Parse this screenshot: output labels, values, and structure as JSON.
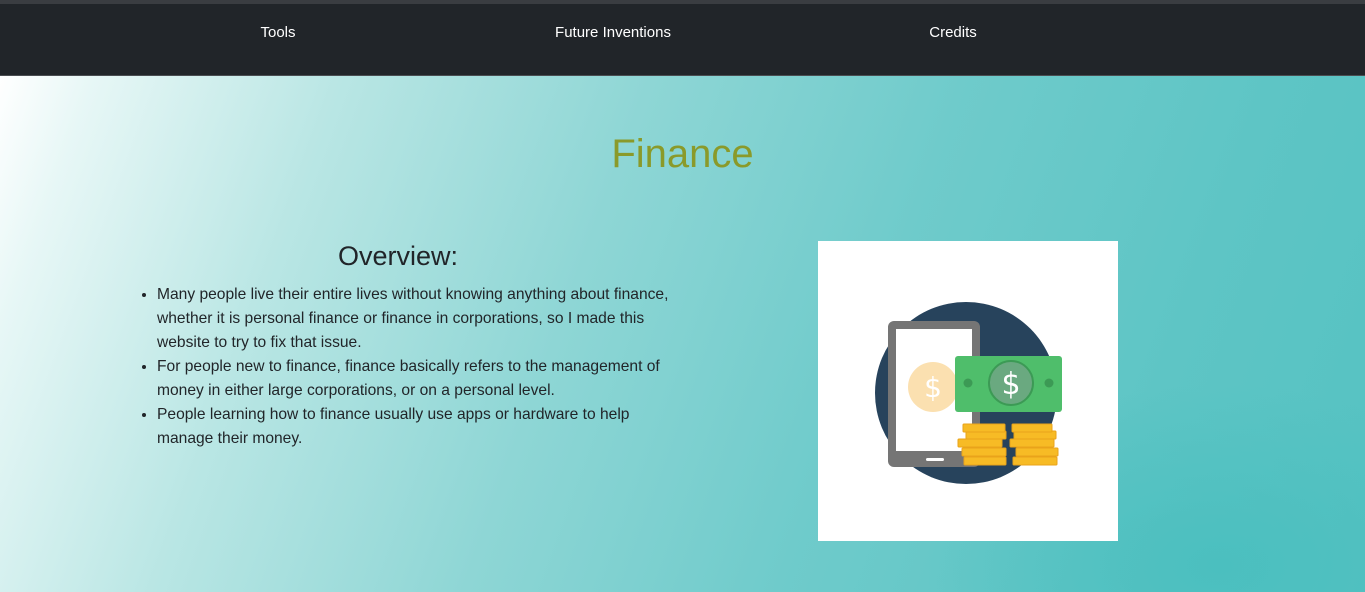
{
  "nav": {
    "items": [
      {
        "label": "Tools"
      },
      {
        "label": "Future Inventions"
      },
      {
        "label": "Credits"
      }
    ]
  },
  "page": {
    "title": "Finance"
  },
  "overview": {
    "heading": "Overview:",
    "bullets": [
      "Many people live their entire lives without knowing anything about finance, whether it is personal finance or finance in corporations, so I made this website to try to fix that issue.",
      "For people new to finance, finance basically refers to the management of money in either large corporations, or on a personal level.",
      "People learning how to finance usually use apps or hardware to help manage their money."
    ]
  },
  "illustration": {
    "coin_symbol": "$",
    "bill_symbol": "$",
    "colors": {
      "circle": "#27435c",
      "phone_frame": "#757575",
      "coin_face": "#fbe0b0",
      "bill": "#4fbe6b",
      "bill_medallion": "#6aa980",
      "coin_stack": "#f7bb25"
    }
  }
}
